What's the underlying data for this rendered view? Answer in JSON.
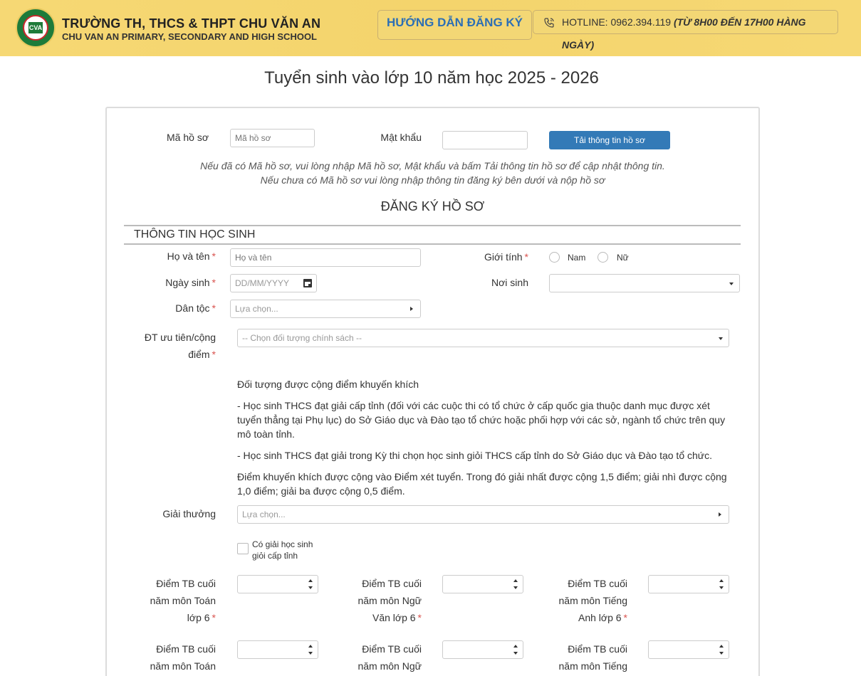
{
  "header": {
    "school_name": "TRƯỜNG TH, THCS & THPT CHU VĂN AN",
    "school_name_en": "CHU VAN AN PRIMARY, SECONDARY AND HIGH SCHOOL",
    "logo_text": "CVA",
    "guide_label": "HƯỚNG DẪN ĐĂNG KÝ",
    "hotline_label": "HOTLINE: 0962.394.119",
    "hotline_hours": "(TỪ 8H00 ĐẾN 17H00 HÀNG NGÀY)"
  },
  "page_title": "Tuyển sinh vào lớp 10 năm học 2025 - 2026",
  "lookup": {
    "code_label": "Mã hồ sơ",
    "code_placeholder": "Mã hồ sơ",
    "password_label": "Mật khẩu",
    "password_value": "",
    "load_button": "Tải thông tin hồ sơ",
    "note_line1": "Nếu đã có Mã hồ sơ, vui lòng nhập Mã hồ sơ, Mật khẩu và bấm Tải thông tin hồ sơ để cập nhật thông tin.",
    "note_line2": "Nếu chưa có Mã hồ sơ vui lòng nhập thông tin đăng ký bên dưới và nộp hồ sơ"
  },
  "register_title": "ĐĂNG KÝ HỒ SƠ",
  "student_section": {
    "heading": "THÔNG TIN HỌC SINH",
    "fullname_label": "Họ và tên",
    "fullname_placeholder": "Họ và tên",
    "gender_label": "Giới tính",
    "gender_options": [
      "Nam",
      "Nữ"
    ],
    "dob_label": "Ngày sinh",
    "dob_placeholder": "DD/MM/YYYY",
    "birthplace_label": "Nơi sinh",
    "birthplace_value": "",
    "ethnicity_label": "Dân tộc",
    "ethnicity_placeholder": "Lựa chọn...",
    "priority_label_1": "ĐT ưu tiên/cộng",
    "priority_label_2": "điểm",
    "priority_placeholder": "-- Chọn đối tượng chính sách --",
    "bonus_title": "Đối tượng được cộng điểm khuyến khích",
    "bonus_item1": "- Học sinh THCS đạt giải cấp tỉnh (đối với các cuộc thi có tổ chức ở cấp quốc gia thuộc danh mục được xét tuyển thẳng tại Phụ lục) do Sở Giáo dục và Đào tạo tổ chức hoặc phối hợp với các sở, ngành tổ chức trên quy mô toàn tỉnh.",
    "bonus_item2": "- Học sinh THCS đạt giải trong Kỳ thi chọn học sinh giỏi THCS cấp tỉnh do Sở Giáo dục và Đào tạo tổ chức.",
    "bonus_item3": "Điểm khuyến khích được cộng vào Điểm xét tuyển. Trong đó giải nhất được cộng 1,5 điểm; giải nhì được cộng 1,0 điểm; giải ba được cộng 0,5 điểm.",
    "award_label": "Giải thưởng",
    "award_placeholder": "Lựa chọn...",
    "provincial_award_checkbox": "Có giải học sinh giỏi cấp tỉnh"
  },
  "scores": {
    "row1": [
      {
        "l1": "Điểm TB cuối",
        "l2": "năm môn Toán",
        "l3": "lớp 6"
      },
      {
        "l1": "Điểm TB cuối",
        "l2": "năm môn Ngữ",
        "l3": "Văn lớp 6"
      },
      {
        "l1": "Điểm TB cuối",
        "l2": "năm môn Tiếng",
        "l3": "Anh lớp 6"
      }
    ],
    "row2": [
      {
        "l1": "Điểm TB cuối",
        "l2": "năm môn Toán"
      },
      {
        "l1": "Điểm TB cuối",
        "l2": "năm môn Ngữ"
      },
      {
        "l1": "Điểm TB cuối",
        "l2": "năm môn Tiếng"
      }
    ]
  },
  "required_mark": "*",
  "colors": {
    "header_bg": "#f5d570",
    "primary": "#337ab7",
    "guide_text": "#2c6fb5",
    "required": "#d9534f",
    "logo_green": "#1e7b3a"
  }
}
